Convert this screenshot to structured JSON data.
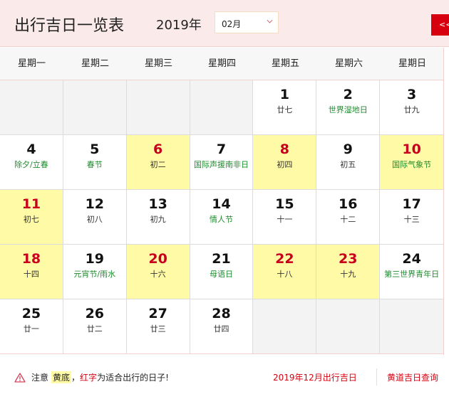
{
  "header": {
    "title": "出行吉日一览表",
    "year": "2019年",
    "month_select": {
      "value": "02月"
    },
    "prev_button_label": "<<"
  },
  "weekdays": [
    "星期一",
    "星期二",
    "星期三",
    "星期四",
    "星期五",
    "星期六",
    "星期日"
  ],
  "calendar": {
    "rows": [
      [
        {
          "day": "",
          "sub": "",
          "type": "empty",
          "festival": false
        },
        {
          "day": "",
          "sub": "",
          "type": "empty",
          "festival": false
        },
        {
          "day": "",
          "sub": "",
          "type": "empty",
          "festival": false
        },
        {
          "day": "",
          "sub": "",
          "type": "empty",
          "festival": false
        },
        {
          "day": "1",
          "sub": "廿七",
          "type": "normal",
          "festival": false
        },
        {
          "day": "2",
          "sub": "世界湿地日",
          "type": "normal",
          "festival": true
        },
        {
          "day": "3",
          "sub": "廿九",
          "type": "normal",
          "festival": false
        }
      ],
      [
        {
          "day": "4",
          "sub": "除夕/立春",
          "type": "normal",
          "festival": true
        },
        {
          "day": "5",
          "sub": "春节",
          "type": "normal",
          "festival": true
        },
        {
          "day": "6",
          "sub": "初二",
          "type": "lucky",
          "festival": false
        },
        {
          "day": "7",
          "sub": "国际声援南非日",
          "type": "normal",
          "festival": true
        },
        {
          "day": "8",
          "sub": "初四",
          "type": "lucky",
          "festival": false
        },
        {
          "day": "9",
          "sub": "初五",
          "type": "normal",
          "festival": false
        },
        {
          "day": "10",
          "sub": "国际气象节",
          "type": "lucky",
          "festival": true
        }
      ],
      [
        {
          "day": "11",
          "sub": "初七",
          "type": "lucky",
          "festival": false
        },
        {
          "day": "12",
          "sub": "初八",
          "type": "normal",
          "festival": false
        },
        {
          "day": "13",
          "sub": "初九",
          "type": "normal",
          "festival": false
        },
        {
          "day": "14",
          "sub": "情人节",
          "type": "normal",
          "festival": true
        },
        {
          "day": "15",
          "sub": "十一",
          "type": "normal",
          "festival": false
        },
        {
          "day": "16",
          "sub": "十二",
          "type": "normal",
          "festival": false
        },
        {
          "day": "17",
          "sub": "十三",
          "type": "normal",
          "festival": false
        }
      ],
      [
        {
          "day": "18",
          "sub": "十四",
          "type": "lucky",
          "festival": false
        },
        {
          "day": "19",
          "sub": "元宵节/雨水",
          "type": "normal",
          "festival": true
        },
        {
          "day": "20",
          "sub": "十六",
          "type": "lucky",
          "festival": false
        },
        {
          "day": "21",
          "sub": "母语日",
          "type": "normal",
          "festival": true
        },
        {
          "day": "22",
          "sub": "十八",
          "type": "lucky",
          "festival": false
        },
        {
          "day": "23",
          "sub": "十九",
          "type": "lucky",
          "festival": false
        },
        {
          "day": "24",
          "sub": "第三世界青年日",
          "type": "normal",
          "festival": true
        }
      ],
      [
        {
          "day": "25",
          "sub": "廿一",
          "type": "normal",
          "festival": false
        },
        {
          "day": "26",
          "sub": "廿二",
          "type": "normal",
          "festival": false
        },
        {
          "day": "27",
          "sub": "廿三",
          "type": "normal",
          "festival": false
        },
        {
          "day": "28",
          "sub": "廿四",
          "type": "normal",
          "festival": false
        },
        {
          "day": "",
          "sub": "",
          "type": "empty",
          "festival": false
        },
        {
          "day": "",
          "sub": "",
          "type": "empty",
          "festival": false
        },
        {
          "day": "",
          "sub": "",
          "type": "empty",
          "festival": false
        }
      ]
    ]
  },
  "footer": {
    "notice_prefix": "注意",
    "notice_yellow": "黄底",
    "notice_comma": "，",
    "notice_red": "红字",
    "notice_suffix": "为适合出行的日子!",
    "link_month": "2019年12月出行吉日",
    "link_query": "黄道吉日查询"
  },
  "colors": {
    "accent_red": "#d6000f",
    "lucky_bg": "#fffaa6",
    "festival_green": "#1e8c2e",
    "header_bg": "#fbeaea"
  }
}
